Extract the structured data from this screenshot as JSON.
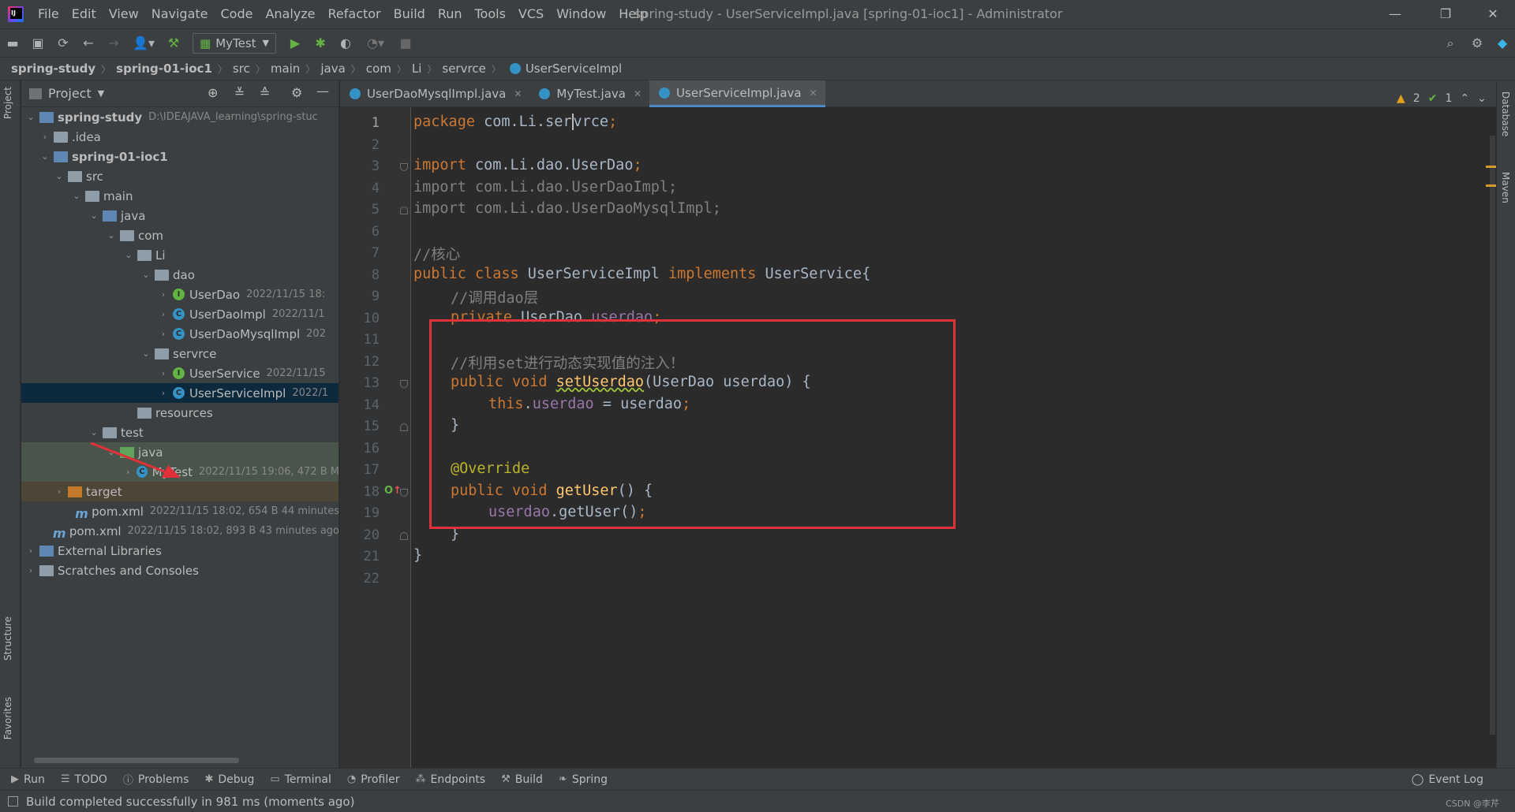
{
  "menu": [
    "File",
    "Edit",
    "View",
    "Navigate",
    "Code",
    "Analyze",
    "Refactor",
    "Build",
    "Run",
    "Tools",
    "VCS",
    "Window",
    "Help"
  ],
  "window_title": "spring-study - UserServiceImpl.java [spring-01-ioc1] - Administrator",
  "run_config": "MyTest",
  "breadcrumb": [
    "spring-study",
    "spring-01-ioc1",
    "src",
    "main",
    "java",
    "com",
    "Li",
    "servrce",
    "UserServiceImpl"
  ],
  "project_panel": {
    "title": "Project",
    "tree": [
      {
        "label": "spring-study",
        "meta": "D:\\IDEAJAVA_learning\\spring-stuc",
        "bold": true
      },
      {
        "label": ".idea",
        "meta": ""
      },
      {
        "label": "spring-01-ioc1",
        "meta": "",
        "bold": true
      },
      {
        "label": "src",
        "meta": ""
      },
      {
        "label": "main",
        "meta": ""
      },
      {
        "label": "java",
        "meta": ""
      },
      {
        "label": "com",
        "meta": ""
      },
      {
        "label": "Li",
        "meta": ""
      },
      {
        "label": "dao",
        "meta": ""
      },
      {
        "label": "UserDao",
        "meta": "2022/11/15 18:"
      },
      {
        "label": "UserDaoImpl",
        "meta": "2022/11/1"
      },
      {
        "label": "UserDaoMysqlImpl",
        "meta": "202"
      },
      {
        "label": "servrce",
        "meta": ""
      },
      {
        "label": "UserService",
        "meta": "2022/11/15"
      },
      {
        "label": "UserServiceImpl",
        "meta": "2022/1"
      },
      {
        "label": "resources",
        "meta": ""
      },
      {
        "label": "test",
        "meta": ""
      },
      {
        "label": "java",
        "meta": ""
      },
      {
        "label": "MyTest",
        "meta": "2022/11/15 19:06, 472 B M"
      },
      {
        "label": "target",
        "meta": ""
      },
      {
        "label": "pom.xml",
        "meta": "2022/11/15 18:02, 654 B 44 minutes"
      },
      {
        "label": "pom.xml",
        "meta": "2022/11/15 18:02, 893 B 43 minutes ago"
      },
      {
        "label": "External Libraries",
        "meta": ""
      },
      {
        "label": "Scratches and Consoles",
        "meta": ""
      }
    ]
  },
  "tabs": [
    "UserDaoMysqlImpl.java",
    "MyTest.java",
    "UserServiceImpl.java"
  ],
  "active_tab": "UserServiceImpl.java",
  "line_numbers": [
    "1",
    "2",
    "3",
    "4",
    "5",
    "6",
    "7",
    "8",
    "9",
    "10",
    "11",
    "12",
    "13",
    "14",
    "15",
    "16",
    "17",
    "18",
    "19",
    "20",
    "21",
    "22"
  ],
  "code": {
    "l1a": "package ",
    "l1b": "com.Li.ser",
    "l1c": "vrce",
    "l1d": ";",
    "l3a": "import ",
    "l3b": "com.Li.dao.UserDao",
    "l3c": ";",
    "l4": "import com.Li.dao.UserDaoImpl;",
    "l5": "import com.Li.dao.UserDaoMysqlImpl;",
    "l7": "//核心",
    "l8a": "public class ",
    "l8b": "UserServiceImpl ",
    "l8c": "implements ",
    "l8d": "UserService{",
    "l9": "//调用dao层",
    "l10a": "private ",
    "l10b": "UserDao ",
    "l10c": "userdao",
    "l10d": ";",
    "l12": "//利用set进行动态实现值的注入！",
    "l13a": "public void ",
    "l13b": "setUserdao",
    "l13c": "(UserDao userdao) {",
    "l14a": "this",
    "l14b": ".",
    "l14c": "userdao",
    "l14d": " = userdao",
    ";": ";",
    "l15": "}",
    "l17": "@Override",
    "l18a": "public void ",
    "l18b": "getUser",
    "l18c": "() {",
    "l19a": "userdao",
    "l19b": ".getUser()",
    "l19c": ";",
    "l20": "}",
    "l21": "}"
  },
  "inspections": {
    "warnings": "2",
    "ok": "1"
  },
  "bottom_tools": [
    "Run",
    "TODO",
    "Problems",
    "Debug",
    "Terminal",
    "Profiler",
    "Endpoints",
    "Build",
    "Spring"
  ],
  "event_log": "Event Log",
  "status": "Build completed successfully in 981 ms (moments ago)",
  "side_labels": {
    "project": "Project",
    "structure": "Structure",
    "favorites": "Favorites",
    "database": "Database",
    "maven": "Maven"
  },
  "watermark": "CSDN @李芹"
}
